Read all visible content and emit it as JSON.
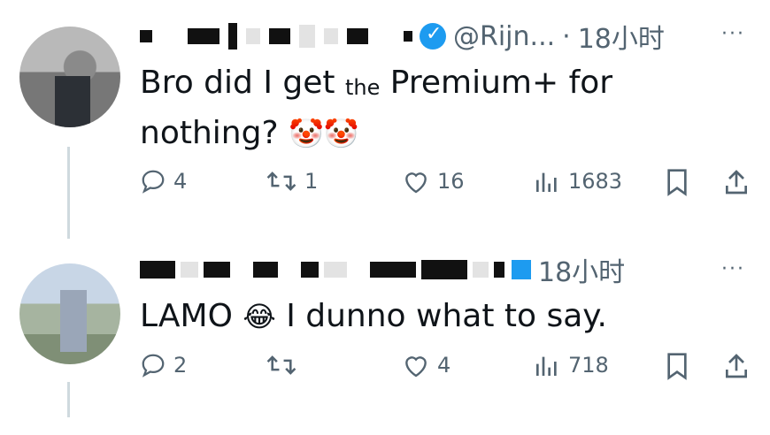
{
  "tweets": [
    {
      "handle": "@Rijn...",
      "separator": "·",
      "time": "18小时",
      "more": "···",
      "text_before": "Bro did I get ",
      "text_obscured": "the",
      "text_after": " Premium+ for nothing?",
      "emojis": "🤡🤡",
      "replies": "4",
      "retweets": "1",
      "likes": "16",
      "views": "1683"
    },
    {
      "handle": "",
      "time": "18小时",
      "more": "···",
      "text_before": "LAMO ",
      "emoji": "😂",
      "text_after": " I dunno what to say.",
      "replies": "2",
      "retweets": "",
      "likes": "4",
      "views": "718"
    }
  ],
  "colors": {
    "text": "#0f1419",
    "secondary": "#536471",
    "verified_blue": "#1d9bf0"
  },
  "icons": [
    "reply-icon",
    "retweet-icon",
    "like-icon",
    "views-icon",
    "bookmark-icon",
    "share-icon",
    "verified-icon",
    "more-icon"
  ]
}
